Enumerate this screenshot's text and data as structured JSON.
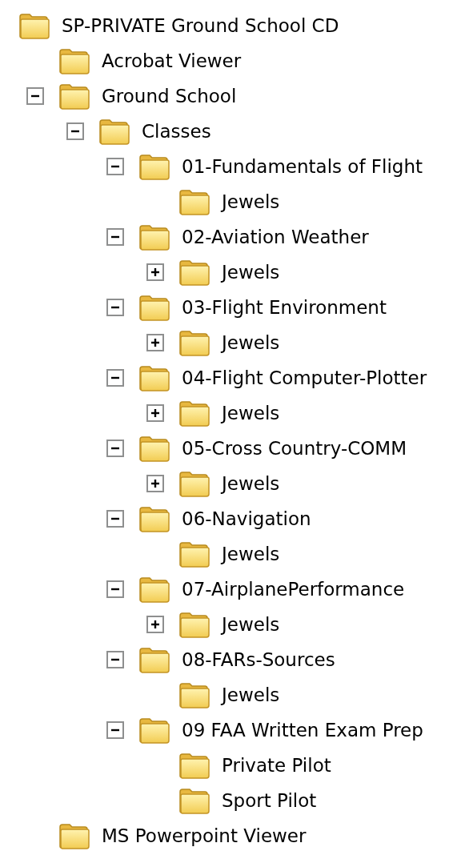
{
  "tree": [
    {
      "label": "SP-PRIVATE Ground School CD",
      "children": [
        {
          "label": "Acrobat Viewer"
        },
        {
          "label": "Ground School",
          "expanded": true,
          "children": [
            {
              "label": "Classes",
              "expanded": true,
              "children": [
                {
                  "label": "01-Fundamentals of Flight",
                  "expanded": true,
                  "children": [
                    {
                      "label": "Jewels"
                    }
                  ]
                },
                {
                  "label": "02-Aviation Weather",
                  "expanded": true,
                  "children": [
                    {
                      "label": "Jewels",
                      "expanded": false
                    }
                  ]
                },
                {
                  "label": "03-Flight Environment",
                  "expanded": true,
                  "children": [
                    {
                      "label": "Jewels",
                      "expanded": false
                    }
                  ]
                },
                {
                  "label": "04-Flight Computer-Plotter",
                  "expanded": true,
                  "children": [
                    {
                      "label": "Jewels",
                      "expanded": false
                    }
                  ]
                },
                {
                  "label": "05-Cross Country-COMM",
                  "expanded": true,
                  "children": [
                    {
                      "label": "Jewels",
                      "expanded": false
                    }
                  ]
                },
                {
                  "label": "06-Navigation",
                  "expanded": true,
                  "children": [
                    {
                      "label": "Jewels"
                    }
                  ]
                },
                {
                  "label": "07-AirplanePerformance",
                  "expanded": true,
                  "children": [
                    {
                      "label": "Jewels",
                      "expanded": false
                    }
                  ]
                },
                {
                  "label": "08-FARs-Sources",
                  "expanded": true,
                  "children": [
                    {
                      "label": "Jewels"
                    }
                  ]
                },
                {
                  "label": "09 FAA Written Exam Prep",
                  "expanded": true,
                  "children": [
                    {
                      "label": "Private Pilot"
                    },
                    {
                      "label": "Sport Pilot"
                    }
                  ]
                }
              ]
            }
          ]
        },
        {
          "label": "MS Powerpoint Viewer"
        }
      ]
    }
  ]
}
